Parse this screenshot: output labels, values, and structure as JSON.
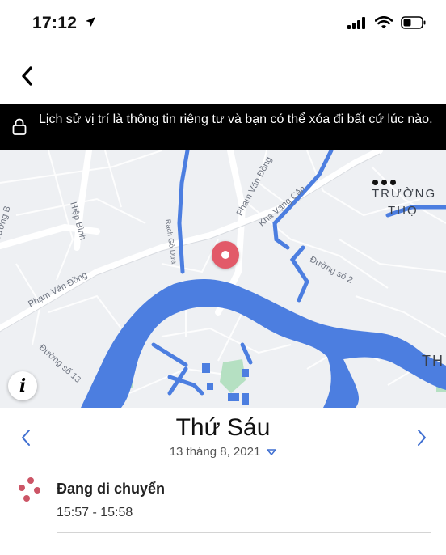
{
  "status_bar": {
    "time": "17:12",
    "icons": [
      "location-arrow-icon",
      "cellular-signal-icon",
      "wifi-icon",
      "battery-icon"
    ]
  },
  "nav": {
    "back_icon": "chevron-left-icon"
  },
  "privacy_banner": {
    "text": "Lịch sử vị trí là thông tin riêng tư và bạn có thể xóa đi bất cứ lúc nào.",
    "icon": "lock-icon"
  },
  "map": {
    "colors": {
      "water": "#4c7ee0",
      "land": "#eef0f3",
      "road": "#ffffff",
      "park": "#b5e0c2",
      "pin": "#e25a69"
    },
    "street_labels": [
      "Phạm Văn Đồng",
      "Hiệp Bình",
      "Đường B",
      "Rạch Gò Dưa",
      "Phạm Văn Đồng",
      "Kha Vạng Cân",
      "Đường số 2",
      "Đường số 13"
    ],
    "place_labels": {
      "truong_tho_1": "TRƯỜNG",
      "truong_tho_2": "THỌ",
      "partial": "TH"
    },
    "info_icon": "info-icon",
    "more_icon": "ellipsis-icon"
  },
  "date_nav": {
    "day": "Thứ Sáu",
    "date": "13 tháng 8, 2021",
    "prev_icon": "chevron-left-icon",
    "next_icon": "chevron-right-icon",
    "dropdown_icon": "triangle-down-icon"
  },
  "timeline": [
    {
      "title": "Đang di chuyển",
      "time": "15:57 - 15:58",
      "icon": "moving-dots-icon",
      "color": "#cc5566"
    }
  ]
}
